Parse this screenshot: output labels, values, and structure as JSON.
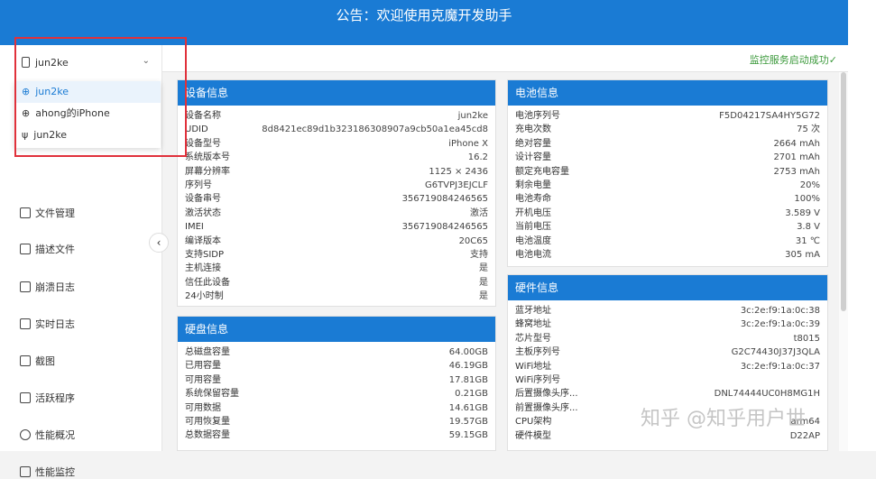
{
  "banner": {
    "text": "公告：欢迎使用克魔开发助手"
  },
  "topbar": {
    "status": "监控服务启动成功✓"
  },
  "device_select": {
    "value": "jun2ke",
    "options": [
      {
        "label": "jun2ke",
        "icon": "globe-icon",
        "selected": true
      },
      {
        "label": "ahong的iPhone",
        "icon": "globe-icon",
        "selected": false
      },
      {
        "label": "jun2ke",
        "icon": "usb-icon",
        "selected": false
      }
    ]
  },
  "menu": [
    {
      "label": "文件管理",
      "icon": "folder-icon"
    },
    {
      "label": "描述文件",
      "icon": "profile-icon"
    },
    {
      "label": "崩溃日志",
      "icon": "crash-log-icon"
    },
    {
      "label": "实时日志",
      "icon": "realtime-log-icon"
    },
    {
      "label": "截图",
      "icon": "screenshot-icon"
    },
    {
      "label": "活跃程序",
      "icon": "active-app-icon"
    },
    {
      "label": "性能概况",
      "icon": "performance-icon"
    },
    {
      "label": "性能监控",
      "icon": "monitor-icon"
    }
  ],
  "device_info": {
    "title": "设备信息",
    "rows": [
      [
        "设备名称",
        "jun2ke"
      ],
      [
        "UDID",
        "8d8421ec89d1b323186308907a9cb50a1ea45cd8"
      ],
      [
        "设备型号",
        "iPhone X"
      ],
      [
        "系统版本号",
        "16.2"
      ],
      [
        "屏幕分辨率",
        "1125 × 2436"
      ],
      [
        "序列号",
        "G6TVPJ3EJCLF"
      ],
      [
        "设备串号",
        "356719084246565"
      ],
      [
        "激活状态",
        "激活"
      ],
      [
        "IMEI",
        "356719084246565"
      ],
      [
        "编译版本",
        "20C65"
      ],
      [
        "支持SIDP",
        "支持"
      ],
      [
        "主机连接",
        "是"
      ],
      [
        "信任此设备",
        "是"
      ],
      [
        "24小时制",
        "是"
      ]
    ]
  },
  "disk_info": {
    "title": "硬盘信息",
    "rows": [
      [
        "总磁盘容量",
        "64.00GB"
      ],
      [
        "已用容量",
        "46.19GB"
      ],
      [
        "可用容量",
        "17.81GB"
      ],
      [
        "系统保留容量",
        "0.21GB"
      ],
      [
        "可用数据",
        "14.61GB"
      ],
      [
        "可用恢复量",
        "19.57GB"
      ],
      [
        "总数据容量",
        "59.15GB"
      ]
    ]
  },
  "battery_info": {
    "title": "电池信息",
    "rows": [
      [
        "电池序列号",
        "F5D04217SA4HY5G72"
      ],
      [
        "充电次数",
        "75 次"
      ],
      [
        "绝对容量",
        "2664 mAh"
      ],
      [
        "设计容量",
        "2701 mAh"
      ],
      [
        "额定充电容量",
        "2753 mAh"
      ],
      [
        "剩余电量",
        "20%"
      ],
      [
        "电池寿命",
        "100%"
      ],
      [
        "开机电压",
        "3.589 V"
      ],
      [
        "当前电压",
        "3.8 V"
      ],
      [
        "电池温度",
        "31 ℃"
      ],
      [
        "电池电流",
        "305 mA"
      ]
    ]
  },
  "hardware_info": {
    "title": "硬件信息",
    "rows": [
      [
        "蓝牙地址",
        "3c:2e:f9:1a:0c:38"
      ],
      [
        "蜂窝地址",
        "3c:2e:f9:1a:0c:39"
      ],
      [
        "芯片型号",
        "t8015"
      ],
      [
        "主板序列号",
        "G2C74430J37J3QLA"
      ],
      [
        "WiFi地址",
        "3c:2e:f9:1a:0c:37"
      ],
      [
        "WiFi序列号",
        ""
      ],
      [
        "后置摄像头序...",
        "DNL74444UC0H8MG1H"
      ],
      [
        "前置摄像头序...",
        ""
      ],
      [
        "CPU架构",
        "arm64"
      ],
      [
        "硬件模型",
        "D22AP"
      ]
    ]
  },
  "watermark": {
    "text": "知乎 @知乎用户世"
  }
}
